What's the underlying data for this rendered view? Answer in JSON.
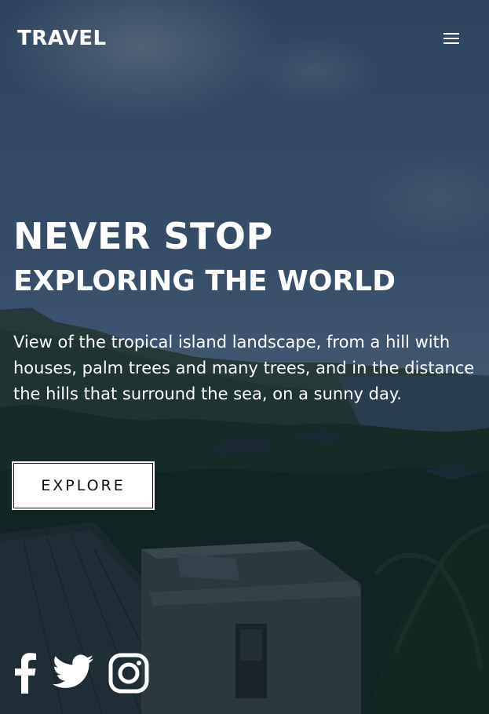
{
  "header": {
    "logo": "TRAVEL",
    "menu_icon": "hamburger-menu-icon"
  },
  "hero": {
    "title_line1": "NEVER STOP",
    "title_line2": "EXPLORING THE WORLD",
    "description": "View of the tropical island landscape, from a hill with houses, palm trees and many trees, and in the distance the hills that surround the sea, on a sunny day.",
    "cta_label": "EXPLORE"
  },
  "social": [
    {
      "name": "facebook-icon"
    },
    {
      "name": "twitter-icon"
    },
    {
      "name": "instagram-icon"
    }
  ],
  "colors": {
    "text": "#ffffff",
    "button_bg": "#ffffff",
    "button_text": "#111111"
  }
}
